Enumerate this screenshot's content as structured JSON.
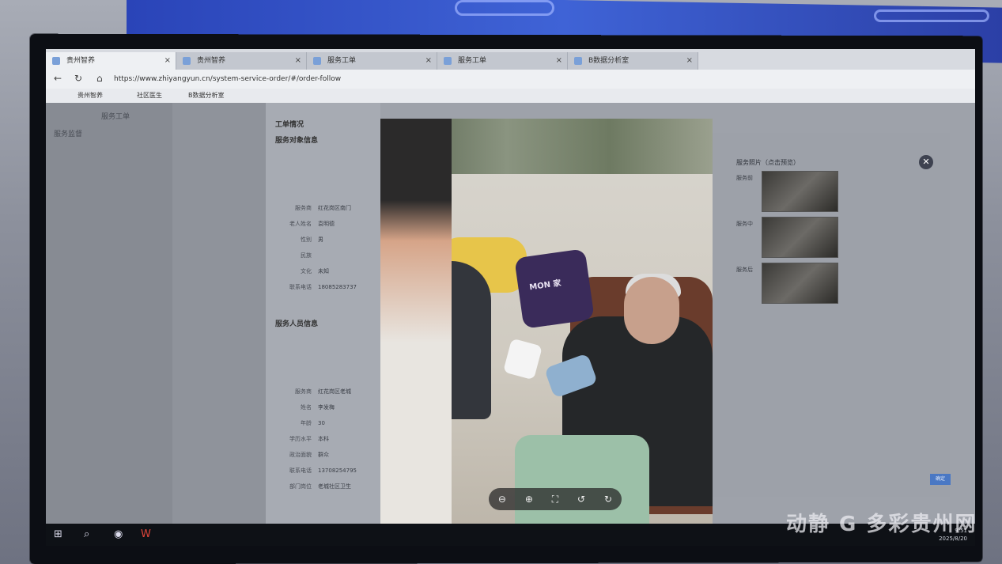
{
  "browser": {
    "tabs": [
      {
        "label": "贵州智养",
        "active": true
      },
      {
        "label": "贵州智养"
      },
      {
        "label": "服务工单"
      },
      {
        "label": "服务工单"
      },
      {
        "label": "B数据分析室"
      }
    ],
    "url": "https://www.zhiyangyun.cn/system-service-order/#/order-follow",
    "bookmarks": [
      "贵州智养",
      "社区医生",
      "B数据分析室"
    ]
  },
  "sidebar": {
    "title": "服务工单",
    "section": "服务监督"
  },
  "order_panel": {
    "section_title": "工单情况",
    "client_title": "服务对象信息",
    "client_fields": [
      {
        "k": "服务商",
        "v": "红花岗区南门"
      },
      {
        "k": "老人姓名",
        "v": "袁明德"
      },
      {
        "k": "性别",
        "v": "男"
      },
      {
        "k": "民族",
        "v": ""
      },
      {
        "k": "文化",
        "v": "未知"
      },
      {
        "k": "联系电话",
        "v": "18085283737"
      }
    ],
    "staff_title": "服务人员信息",
    "staff_fields": [
      {
        "k": "服务商",
        "v": "红花岗区老城"
      },
      {
        "k": "姓名",
        "v": "李发梅"
      },
      {
        "k": "年龄",
        "v": "30"
      },
      {
        "k": "学历水平",
        "v": "本科"
      },
      {
        "k": "政治面貌",
        "v": "群众"
      },
      {
        "k": "联系电话",
        "v": "13708254795"
      },
      {
        "k": "部门岗位",
        "v": "老城社区卫生"
      }
    ]
  },
  "photo": {
    "pillow_text": "MON 家"
  },
  "service_photos": {
    "title": "服务照片（点击预览）",
    "labels": [
      "服务前",
      "服务中",
      "服务后"
    ],
    "confirm": "确定"
  },
  "taskbar": {
    "time": "9:51",
    "date": "2025/8/20"
  },
  "watermark": "动静 G 多彩贵州网",
  "colors": {
    "banner": "#3f63d6",
    "overlay": "#9ea2aa"
  }
}
